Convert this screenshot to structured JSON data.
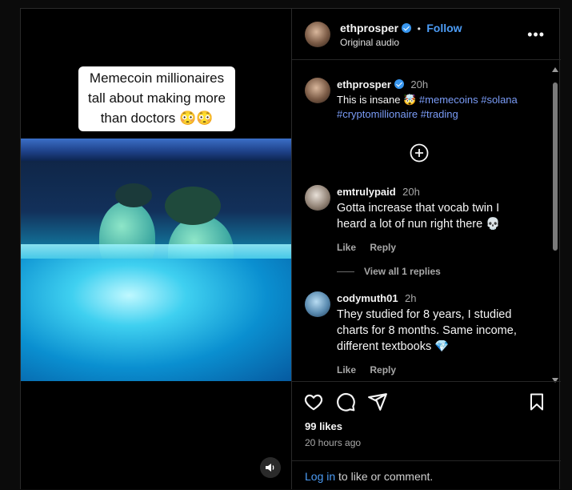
{
  "video": {
    "caption_lines": [
      "Memecoin millionaires",
      "tall about making more",
      "than doctors 😳😳"
    ]
  },
  "header": {
    "username": "ethprosper",
    "separator": "•",
    "follow_label": "Follow",
    "audio_label": "Original audio",
    "more_label": "•••"
  },
  "post": {
    "username": "ethprosper",
    "time": "20h",
    "text_prefix": "This is insane 🤯",
    "hashtags_line1": "#memecoins #solana",
    "hashtags_line2": "#cryptomillionaire #trading",
    "load_more_icon": "plus-circle-icon"
  },
  "comments": [
    {
      "username": "emtrulypaid",
      "time": "20h",
      "lines": [
        "Gotta increase that vocab twin I",
        "heard a lot of nun right there 💀"
      ],
      "like_label": "Like",
      "reply_label": "Reply",
      "view_replies_label": "View all 1 replies"
    },
    {
      "username": "codymuth01",
      "time": "2h",
      "lines": [
        "They studied for 8 years, I studied",
        "charts for 8 months. Same income,",
        "different textbooks 💎"
      ],
      "like_label": "Like",
      "reply_label": "Reply"
    }
  ],
  "actions": {
    "icons": [
      "heart-icon",
      "comment-icon",
      "share-icon",
      "bookmark-icon"
    ],
    "likes": "99 likes",
    "time_ago": "20 hours ago",
    "login_link": "Log in",
    "login_rest": " to like or comment."
  },
  "colors": {
    "link": "#4c9cf5",
    "hashtag": "#7a9cf7",
    "verified": "#3897f0",
    "background": "#000000"
  }
}
